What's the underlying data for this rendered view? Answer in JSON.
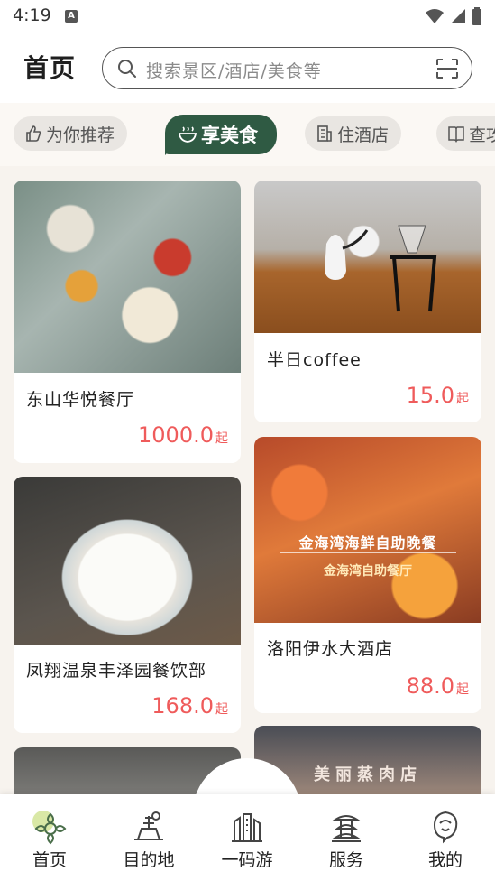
{
  "status": {
    "time": "4:19"
  },
  "header": {
    "title": "首页",
    "search_placeholder": "搜索景区/酒店/美食等"
  },
  "tabs": [
    {
      "label": "为你推荐",
      "icon": "thumbs-up-icon",
      "active": false
    },
    {
      "label": "享美食",
      "icon": "food-bowl-icon",
      "active": true
    },
    {
      "label": "住酒店",
      "icon": "building-icon",
      "active": false
    },
    {
      "label": "查攻",
      "icon": "book-icon",
      "active": false
    }
  ],
  "cards": [
    {
      "name": "东山华悦餐厅",
      "price": "1000.0",
      "unit": "起"
    },
    {
      "name": "半日coffee",
      "price": "15.0",
      "unit": "起"
    },
    {
      "name": "凤翔温泉丰泽园餐饮部",
      "price": "168.0",
      "unit": "起"
    },
    {
      "name": "洛阳伊水大酒店",
      "price": "88.0",
      "unit": "起"
    }
  ],
  "image_text": {
    "seafood_title": "金海湾海鲜自助晚餐",
    "seafood_sub": "金海湾自助餐厅",
    "shop_sign": "美丽蒸肉店"
  },
  "nav": [
    {
      "label": "首页",
      "icon": "home-flower-icon",
      "active": true
    },
    {
      "label": "目的地",
      "icon": "destination-icon",
      "active": false
    },
    {
      "label": "一码游",
      "icon": "qr-travel-icon",
      "active": false
    },
    {
      "label": "服务",
      "icon": "service-pagoda-icon",
      "active": false
    },
    {
      "label": "我的",
      "icon": "profile-icon",
      "active": false
    }
  ],
  "colors": {
    "accent_green": "#2f5a43",
    "price_red": "#ef5b5b",
    "background": "#f7f3ee"
  }
}
